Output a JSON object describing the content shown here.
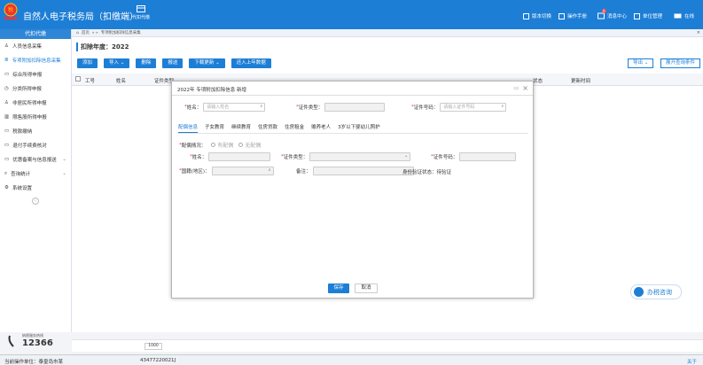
{
  "app": {
    "title": "自然人电子税务局（扣缴端）",
    "toolbar_label": "代扣代缴"
  },
  "header": {
    "upgrade": "版本切换",
    "manual": "操作手册",
    "messages": "消息中心",
    "message_count": "0",
    "unit_manage": "单位管理",
    "online": "在线"
  },
  "sidebar": {
    "header": "代扣代缴",
    "items": [
      {
        "label": "人员信息采集",
        "icon": "person-icon"
      },
      {
        "label": "专项附加扣除信息采集",
        "icon": "list-icon"
      },
      {
        "label": "综合所得申报",
        "icon": "doc-icon"
      },
      {
        "label": "分类所得申报",
        "icon": "clock-icon"
      },
      {
        "label": "非居民所得申报",
        "icon": "person-icon"
      },
      {
        "label": "限售股所得申报",
        "icon": "chart-icon"
      },
      {
        "label": "税款缴纳",
        "icon": "doc-icon"
      },
      {
        "label": "退付手续费核对",
        "icon": "doc-icon"
      },
      {
        "label": "优惠备案与信息报送",
        "icon": "doc-icon"
      },
      {
        "label": "查询统计",
        "icon": "search-icon"
      },
      {
        "label": "系统设置",
        "icon": "gear-icon"
      }
    ]
  },
  "hotline": {
    "label": "纳税服务热线",
    "number": "12366"
  },
  "breadcrumb": {
    "home": "首页",
    "current": "专项附加扣除信息采集",
    "sep": "» »"
  },
  "page": {
    "year_label": "扣除年度：2022"
  },
  "buttons": {
    "add": "添加",
    "import": "导入",
    "delete": "删除",
    "submit": "报送",
    "download": "下载更新",
    "carry": "还入上年数据",
    "export": "导出",
    "expand": "展开查询条件"
  },
  "table": {
    "columns": [
      "工号",
      "姓名",
      "证件类型",
      "证件号码",
      "",
      "",
      "",
      "",
      "",
      "",
      "状态",
      "更新时间"
    ]
  },
  "pager": {
    "page_size": "1000"
  },
  "status": {
    "unit_label": "当前操作单位：泰皇岛市某",
    "tax_id": "43477220021J",
    "close": "关于"
  },
  "dialog": {
    "title": "2022年 专项附加扣除信息 新增",
    "name_label": "姓名：",
    "name_placeholder": "请输入姓名",
    "idtype_label": "证件类型：",
    "idno_label": "证件号码：",
    "idno_placeholder": "请输入证件号码",
    "tabs": [
      "配偶信息",
      "子女教育",
      "继续教育",
      "住房贷款",
      "住房租金",
      "赡养老人",
      "3岁以下婴幼儿照护"
    ],
    "spouse_label": "配偶情况：",
    "opt_yes": "有配偶",
    "opt_no": "无配偶",
    "sp_name": "姓名：",
    "sp_idtype": "证件类型：",
    "sp_idno": "证件号码：",
    "nation": "国籍(地区)：",
    "remark": "备注：",
    "verify": "身份验证状态：待验证",
    "save": "保存",
    "cancel": "取消"
  },
  "chat": {
    "label": "办税咨询"
  },
  "colors": {
    "primary": "#1d7ed6",
    "header": "#1d7ed6"
  }
}
